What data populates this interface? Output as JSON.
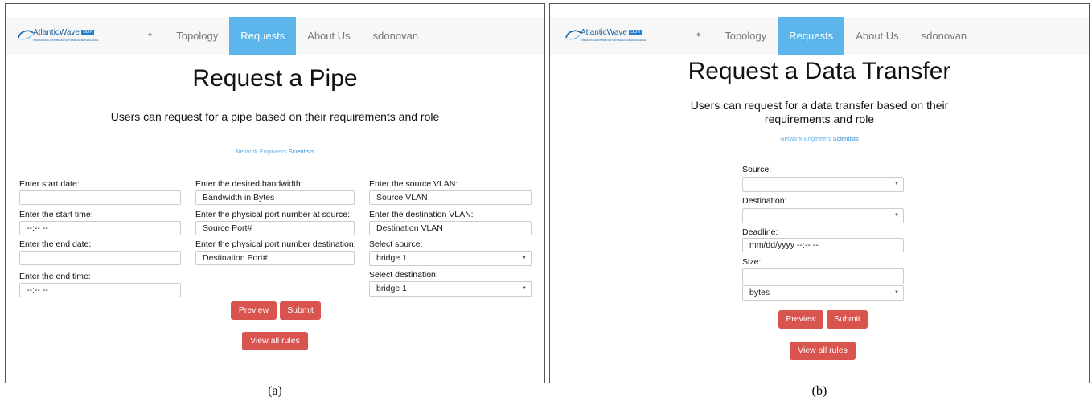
{
  "brand": {
    "name": "AtlanticWave",
    "badge": "SDX",
    "tagline": "INTERNATIONAL DISTRIBUTED SOFTWARE DEFINED EXCHANGE"
  },
  "panel_a": {
    "nav": {
      "home_icon": "home-icon",
      "items": [
        "Topology",
        "Requests",
        "About Us",
        "sdonovan"
      ],
      "active": "Requests"
    },
    "title": "Request a Pipe",
    "subtitle": "Users can request for a pipe based on their requirements and role",
    "roles": {
      "engineers": "Network Engineers",
      "scientists": "Scientists"
    },
    "form": {
      "start_date_label": "Enter start date:",
      "start_date_value": "",
      "start_time_label": "Enter the start time:",
      "start_time_value": "--:-- --",
      "end_date_label": "Enter the end date:",
      "end_date_value": "",
      "end_time_label": "Enter the end time:",
      "end_time_value": "--:-- --",
      "bandwidth_label": "Enter the desired bandwidth:",
      "bandwidth_placeholder": "Bandwidth in Bytes",
      "src_port_label": "Enter the physical port number at source:",
      "src_port_placeholder": "Source Port#",
      "dst_port_label": "Enter the physical port number destination:",
      "dst_port_placeholder": "Destination Port#",
      "src_vlan_label": "Enter the source VLAN:",
      "src_vlan_placeholder": "Source VLAN",
      "dst_vlan_label": "Enter the destination VLAN:",
      "dst_vlan_placeholder": "Destination VLAN",
      "select_source_label": "Select source:",
      "select_source_value": "bridge 1",
      "select_dest_label": "Select destination:",
      "select_dest_value": "bridge 1"
    },
    "buttons": {
      "preview": "Preview",
      "submit": "Submit",
      "view_all": "View all rules"
    },
    "caption": "(a)"
  },
  "panel_b": {
    "nav": {
      "home_icon": "home-icon",
      "items": [
        "Topology",
        "Requests",
        "About Us",
        "sdonovan"
      ],
      "active": "Requests"
    },
    "title": "Request a Data Transfer",
    "subtitle_line1": "Users can request for a data transfer based on their",
    "subtitle_line2": "requirements and role",
    "roles": {
      "engineers": "Network Engineers",
      "scientists": "Scientists"
    },
    "form": {
      "source_label": "Source:",
      "source_value": "",
      "destination_label": "Destination:",
      "destination_value": "",
      "deadline_label": "Deadline:",
      "deadline_value": "mm/dd/yyyy --:-- --",
      "size_label": "Size:",
      "size_value": "",
      "unit_value": "bytes"
    },
    "buttons": {
      "preview": "Preview",
      "submit": "Submit",
      "view_all": "View all rules"
    },
    "caption": "(b)"
  },
  "colors": {
    "nav_active": "#5bb5ea",
    "button": "#d9534f",
    "role_link": "#6ab4e8",
    "brand": "#1a5fa0"
  }
}
